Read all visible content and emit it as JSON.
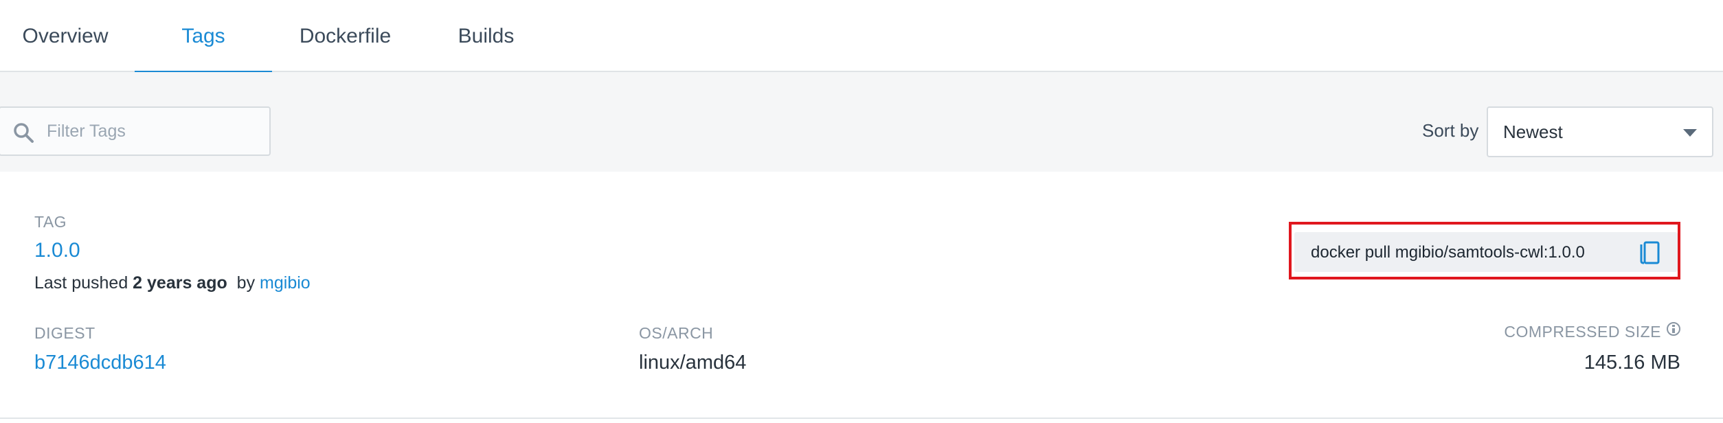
{
  "tabs": [
    {
      "label": "Overview",
      "active": false
    },
    {
      "label": "Tags",
      "active": true
    },
    {
      "label": "Dockerfile",
      "active": false
    },
    {
      "label": "Builds",
      "active": false
    }
  ],
  "filter": {
    "placeholder": "Filter Tags",
    "value": ""
  },
  "sort": {
    "label": "Sort by",
    "selected": "Newest"
  },
  "tag_card": {
    "tag_label": "TAG",
    "tag_name": "1.0.0",
    "last_pushed_prefix": "Last pushed",
    "last_pushed_time": "2 years ago",
    "by_text": "by",
    "pushed_by": "mgibio",
    "pull_command": "docker pull mgibio/samtools-cwl:1.0.0",
    "digest_label": "DIGEST",
    "digest_value": "b7146dcdb614",
    "os_arch_label": "OS/ARCH",
    "os_arch_value": "linux/amd64",
    "compressed_size_label": "COMPRESSED SIZE",
    "compressed_size_value": "145.16 MB"
  },
  "colors": {
    "accent": "#1a8ad4",
    "highlight": "#e0171e",
    "background": "#f5f6f7"
  },
  "icons": [
    "search-icon",
    "chevron-down-icon",
    "copy-icon",
    "info-icon"
  ]
}
